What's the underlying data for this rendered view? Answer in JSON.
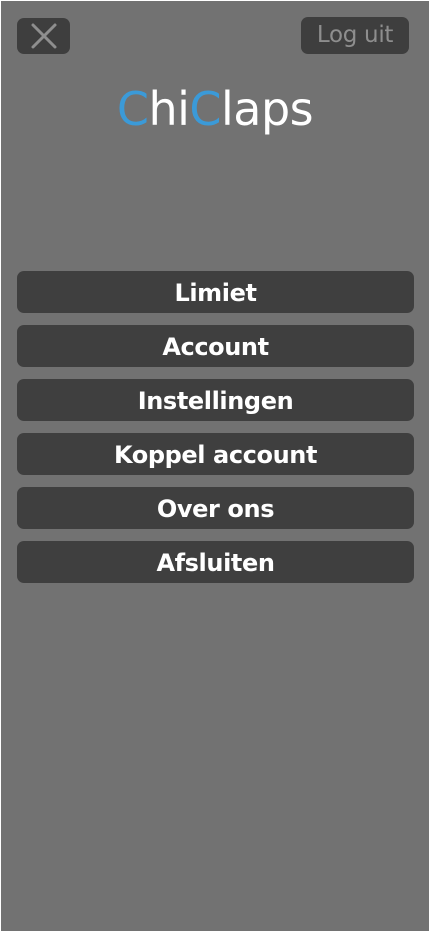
{
  "header": {
    "close_icon": "close-icon",
    "logout_label": "Log uit"
  },
  "logo": {
    "part1": "C",
    "part2": "hi",
    "part3": "C",
    "part4": "laps",
    "accent_color": "#3b9ad8"
  },
  "colors": {
    "background": "#727272",
    "button": "#3f3f3f",
    "text": "#ffffff",
    "muted_text": "#8e8e8e"
  },
  "menu": {
    "items": [
      {
        "label": "Limiet"
      },
      {
        "label": "Account"
      },
      {
        "label": "Instellingen"
      },
      {
        "label": "Koppel account"
      },
      {
        "label": "Over ons"
      },
      {
        "label": "Afsluiten"
      }
    ]
  }
}
